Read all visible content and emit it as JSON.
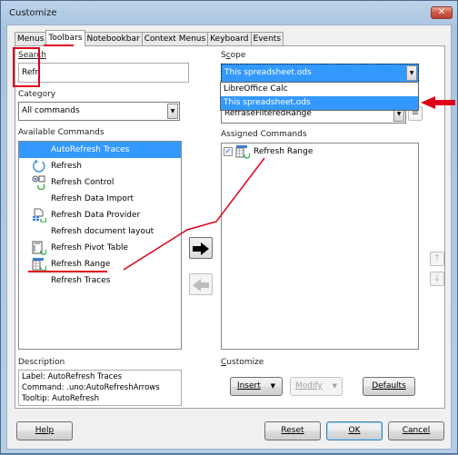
{
  "window": {
    "title": "Customize",
    "close_icon": "close-icon"
  },
  "tabs": [
    {
      "label": "Menus",
      "active": false
    },
    {
      "label": "Toolbars",
      "active": true
    },
    {
      "label": "Notebookbar",
      "active": false
    },
    {
      "label": "Context Menus",
      "active": false
    },
    {
      "label": "Keyboard",
      "active": false
    },
    {
      "label": "Events",
      "active": false
    }
  ],
  "left": {
    "search_label": "Search",
    "search_value": "Refr",
    "category_label": "Category",
    "category_value": "All commands",
    "available_label": "Available Commands",
    "available_commands": [
      {
        "label": "AutoRefresh Traces",
        "icon": "none",
        "selected": true
      },
      {
        "label": "Refresh",
        "icon": "refresh-icon",
        "selected": false
      },
      {
        "label": "Refresh Control",
        "icon": "refresh-control-icon",
        "selected": false
      },
      {
        "label": "Refresh Data Import",
        "icon": "none",
        "selected": false
      },
      {
        "label": "Refresh Data Provider",
        "icon": "refresh-data-provider-icon",
        "selected": false
      },
      {
        "label": "Refresh document layout",
        "icon": "none",
        "selected": false
      },
      {
        "label": "Refresh Pivot Table",
        "icon": "refresh-pivot-table-icon",
        "selected": false
      },
      {
        "label": "Refresh Range",
        "icon": "refresh-range-icon",
        "selected": false
      },
      {
        "label": "Refresh Traces",
        "icon": "none",
        "selected": false
      }
    ],
    "description_label": "Description",
    "description_lines": [
      "Label: AutoRefresh Traces",
      "Command: .uno:AutoRefreshArrows",
      "Tooltip: AutoRefresh"
    ]
  },
  "right": {
    "scope_label": "Scope",
    "scope_value": "This spreadsheet.ods",
    "scope_options": [
      {
        "label": "LibreOffice Calc",
        "selected": false
      },
      {
        "label": "This spreadsheet.ods",
        "selected": true
      }
    ],
    "target_value": "RefraseFilteredRange",
    "assigned_label": "Assigned Commands",
    "assigned_commands": [
      {
        "label": "Refresh Range",
        "checked": true,
        "icon": "refresh-range-icon"
      }
    ],
    "customize_label": "Customize",
    "insert_label": "Insert",
    "modify_label": "Modify",
    "defaults_label": "Defaults"
  },
  "footer": {
    "help_label": "Help",
    "reset_label": "Reset",
    "ok_label": "OK",
    "cancel_label": "Cancel"
  },
  "colors": {
    "selection": "#3399ff",
    "annotation": "#e0001a"
  }
}
